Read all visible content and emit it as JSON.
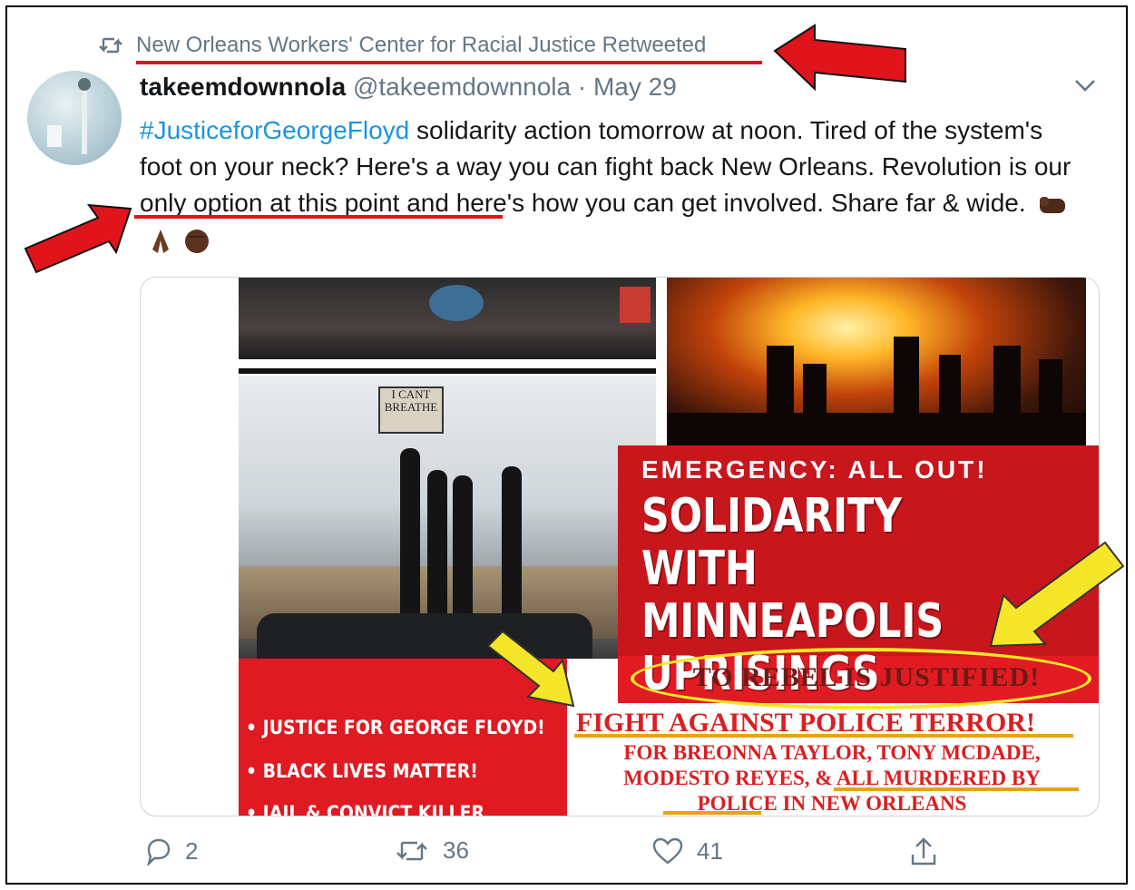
{
  "retweet": {
    "text": "New Orleans Workers' Center for Racial Justice Retweeted"
  },
  "tweet": {
    "name": "takeemdownnola",
    "handle": "@takeemdownnola",
    "separator": " · ",
    "date": "May 29",
    "hashtag": "#JusticeforGeorgeFloyd",
    "text1": " solidarity action tomorrow at noon. Tired of the system's foot on your neck? Here's a way you can fight back New Orleans. ",
    "text2": "Revolution is our only option",
    "text3": " at this point and here's how you can get involved. Share far & wide."
  },
  "card": {
    "sign": "I CANT BREATHE",
    "emergency": "EMERGENCY: ALL OUT!",
    "headline_1": "SOLIDARITY WITH",
    "headline_2": "MINNEAPOLIS",
    "headline_3": "UPRISINGS",
    "rebel": "TO REBEL IS JUSTIFIED!",
    "bullet_1": "• JUSTICE FOR GEORGE FLOYD!",
    "bullet_2": "• BLACK LIVES MATTER!",
    "bullet_3": "• JAIL & CONVICT KILLER",
    "fight": "FIGHT AGAINST POLICE TERROR!",
    "names_1": "FOR BREONNA TAYLOR, TONY MCDADE,",
    "names_2": "MODESTO REYES, & ALL MURDERED BY",
    "names_3": "POLICE IN NEW ORLEANS"
  },
  "actions": {
    "replies": "2",
    "retweets": "36",
    "likes": "41"
  },
  "colors": {
    "link": "#1b95e0",
    "muted": "#657786",
    "annotation_red": "#e0141b",
    "annotation_yellow": "#f5e62a"
  }
}
